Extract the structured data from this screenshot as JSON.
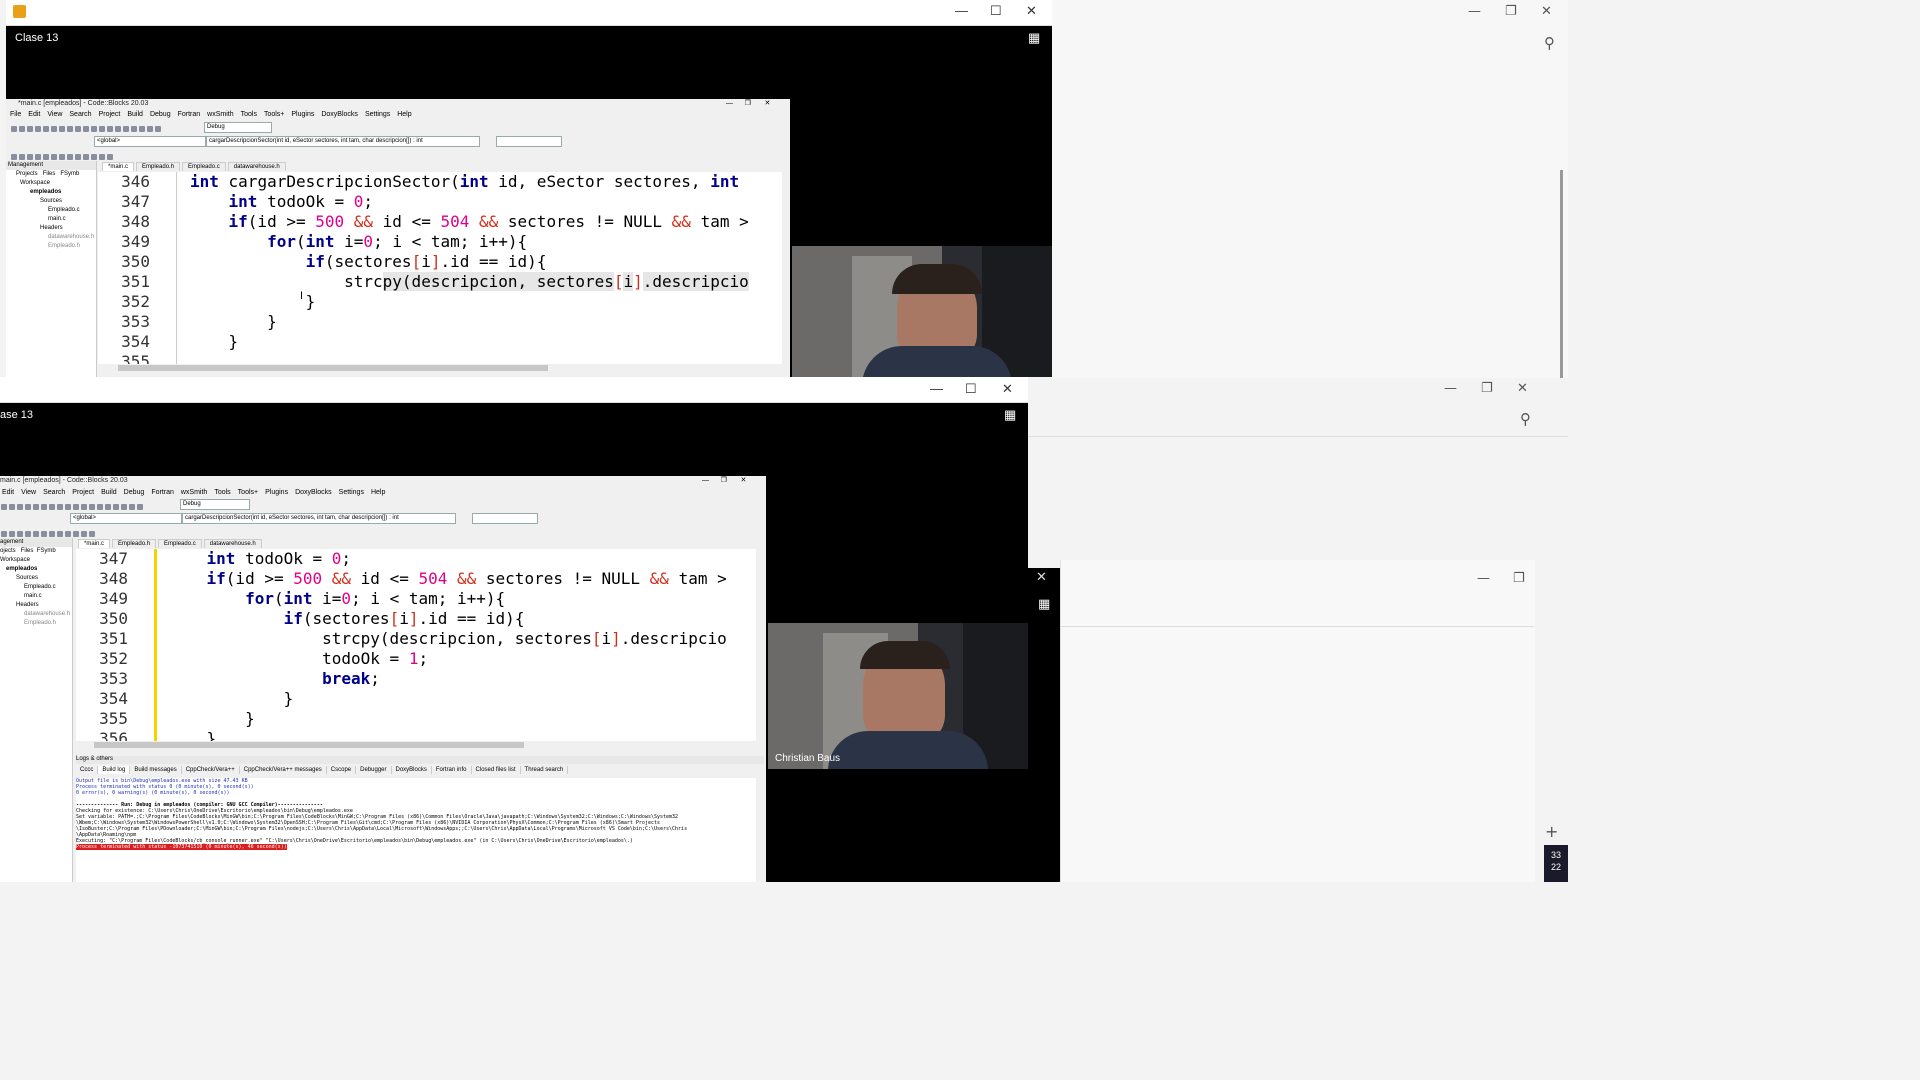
{
  "top_player": {
    "title": "Clase 13",
    "controls": [
      "—",
      "☐",
      "✕"
    ]
  },
  "bottom_player": {
    "title": "ase 13",
    "controls": [
      "—",
      "☐",
      "✕"
    ]
  },
  "codeblocks": {
    "title_top": "*main.c [empleados] - Code::Blocks 20.03",
    "title_bottom": "main.c [empleados] - Code::Blocks 20.03",
    "menu_top": [
      "File",
      "Edit",
      "View",
      "Search",
      "Project",
      "Build",
      "Debug",
      "Fortran",
      "wxSmith",
      "Tools",
      "Tools+",
      "Plugins",
      "DoxyBlocks",
      "Settings",
      "Help"
    ],
    "menu_bottom": [
      "Edit",
      "View",
      "Search",
      "Project",
      "Build",
      "Debug",
      "Fortran",
      "wxSmith",
      "Tools",
      "Tools+",
      "Plugins",
      "DoxyBlocks",
      "Settings",
      "Help"
    ],
    "build_target": "Debug",
    "scope": "<global>",
    "function_combo": "cargarDescripcionSector(int id, eSector sectores, int tam, char descripcion[]) : int",
    "file_tabs_top": [
      "*main.c",
      "Empleado.h",
      "Empleado.c",
      "datawarehouse.h"
    ],
    "file_tabs_bottom": [
      "*main.c",
      "Empleado.h",
      "Empleado.c",
      "datawarehouse.h"
    ],
    "management": {
      "label": "Management",
      "tabs": [
        "Projects",
        "Files",
        "FSymb"
      ],
      "tree": [
        "Workspace",
        "empleados",
        "Sources",
        "Empleado.c",
        "main.c",
        "Headers",
        "datawarehouse.h",
        "Empleado.h"
      ]
    },
    "logs": {
      "label": "Logs & others",
      "tabs": [
        "Cccc",
        "Build log",
        "Build messages",
        "CppCheck/Vera++",
        "CppCheck/Vera++ messages",
        "Cscope",
        "Debugger",
        "DoxyBlocks",
        "Fortran info",
        "Closed files list",
        "Thread search"
      ],
      "lines": [
        "Output file is bin\\Debug\\empleados.exe with size 47.43 KB",
        "Process terminated with status 0 (0 minute(s), 0 second(s))",
        "0 error(s), 0 warning(s) (0 minute(s), 0 second(s))",
        "",
        "-------------- Run: Debug in empleados (compiler: GNU GCC Compiler)---------------",
        "Checking for existence: C:\\Users\\Chris\\OneDrive\\Escritorio\\empleados\\bin\\Debug\\empleados.exe",
        "Set variable: PATH=.;C:\\Program Files\\CodeBlocks\\MinGW\\bin;C:\\Program Files\\CodeBlocks\\MinGW;C:\\Program Files (x86)\\Common Files\\Oracle\\Java\\javapath;C:\\Windows\\System32;C:\\Windows;C:\\Windows\\System32",
        "\\Wbem;C:\\Windows\\System32\\WindowsPowerShell\\v1.0;C:\\Windows\\System32\\OpenSSH;C:\\Program Files\\Git\\cmd;C:\\Program Files (x86)\\NVIDIA Corporation\\PhysX\\Common;C:\\Program Files (x86)\\Smart Projects",
        "\\IsoBuster;C:\\Program Files\\PDownloader;C:\\MinGW\\bin;C:\\Program Files\\nodejs;C:\\Users\\Chris\\AppData\\Local\\Microsoft\\WindowsApps;;C:\\Users\\Chris\\AppData\\Local\\Programs\\Microsoft VS Code\\bin;C:\\Users\\Chris",
        "\\AppData\\Roaming\\npm",
        "Executing: \"C:\\Program Files\\CodeBlocks/cb_console_runner.exe\" \"C:\\Users\\Chris\\OneDrive\\Escritorio\\empleados\\bin\\Debug\\empleados.exe\"  (in C:\\Users\\Chris\\OneDrive\\Escritorio\\empleados\\.)",
        "Process terminated with status -1073741510 (0 minute(s), 46 second(s))"
      ]
    }
  },
  "code_top": [
    {
      "n": "346",
      "segs": [
        [
          "kw",
          "int"
        ],
        [
          "t",
          " cargarDescripcionSector("
        ],
        [
          "kw",
          "int"
        ],
        [
          "t",
          " id, eSector sectores, "
        ],
        [
          "kw",
          "int"
        ]
      ]
    },
    {
      "n": "347",
      "segs": [
        [
          "t",
          "    "
        ],
        [
          "kw",
          "int"
        ],
        [
          "t",
          " todoOk = "
        ],
        [
          "num",
          "0"
        ],
        [
          "t",
          ";"
        ]
      ]
    },
    {
      "n": "348",
      "segs": [
        [
          "t",
          "    "
        ],
        [
          "kw",
          "if"
        ],
        [
          "t",
          "(id >= "
        ],
        [
          "num",
          "500"
        ],
        [
          "op",
          " && "
        ],
        [
          "t",
          "id <= "
        ],
        [
          "num",
          "504"
        ],
        [
          "op",
          " && "
        ],
        [
          "t",
          "sectores != NULL "
        ],
        [
          "op",
          "&&"
        ],
        [
          "t",
          " tam >"
        ]
      ]
    },
    {
      "n": "349",
      "segs": [
        [
          "t",
          "        "
        ],
        [
          "kw",
          "for"
        ],
        [
          "t",
          "("
        ],
        [
          "kw",
          "int"
        ],
        [
          "t",
          " i="
        ],
        [
          "num",
          "0"
        ],
        [
          "t",
          "; i < tam; i++){"
        ]
      ]
    },
    {
      "n": "350",
      "segs": [
        [
          "t",
          "            "
        ],
        [
          "kw",
          "if"
        ],
        [
          "t",
          "(sectores"
        ],
        [
          "op",
          "["
        ],
        [
          "t",
          "i"
        ],
        [
          "op",
          "]"
        ],
        [
          "t",
          ".id == id){"
        ]
      ]
    },
    {
      "n": "351",
      "segs": [
        [
          "t",
          "                strc"
        ],
        [
          "sel",
          "py(descripcion, sectores"
        ],
        [
          "op",
          "["
        ],
        [
          "sel",
          "i"
        ],
        [
          "op",
          "]"
        ],
        [
          "sel",
          ".descripcio"
        ]
      ]
    },
    {
      "n": "352",
      "segs": [
        [
          "t",
          "            }"
        ]
      ]
    },
    {
      "n": "353",
      "segs": [
        [
          "t",
          "        }"
        ]
      ]
    },
    {
      "n": "354",
      "segs": [
        [
          "t",
          "    }"
        ]
      ]
    },
    {
      "n": "355",
      "segs": [
        [
          "t",
          ""
        ]
      ]
    }
  ],
  "code_bottom": [
    {
      "n": "347",
      "segs": [
        [
          "t",
          "    "
        ],
        [
          "kw",
          "int"
        ],
        [
          "t",
          " todoOk = "
        ],
        [
          "num",
          "0"
        ],
        [
          "t",
          ";"
        ]
      ]
    },
    {
      "n": "348",
      "segs": [
        [
          "t",
          "    "
        ],
        [
          "kw",
          "if"
        ],
        [
          "t",
          "(id >= "
        ],
        [
          "num",
          "500"
        ],
        [
          "op",
          " && "
        ],
        [
          "t",
          "id <= "
        ],
        [
          "num",
          "504"
        ],
        [
          "op",
          " && "
        ],
        [
          "t",
          "sectores != NULL "
        ],
        [
          "op",
          "&&"
        ],
        [
          "t",
          " tam >"
        ]
      ]
    },
    {
      "n": "349",
      "segs": [
        [
          "t",
          "        "
        ],
        [
          "kw",
          "for"
        ],
        [
          "t",
          "("
        ],
        [
          "kw",
          "int"
        ],
        [
          "t",
          " i="
        ],
        [
          "num",
          "0"
        ],
        [
          "t",
          "; i < tam; i++){"
        ]
      ]
    },
    {
      "n": "350",
      "segs": [
        [
          "t",
          "            "
        ],
        [
          "kw",
          "if"
        ],
        [
          "t",
          "(sectores"
        ],
        [
          "op",
          "["
        ],
        [
          "t",
          "i"
        ],
        [
          "op",
          "]"
        ],
        [
          "t",
          ".id == id){"
        ]
      ]
    },
    {
      "n": "351",
      "segs": [
        [
          "t",
          "                strcpy(descripcion, sectores"
        ],
        [
          "op",
          "["
        ],
        [
          "t",
          "i"
        ],
        [
          "op",
          "]"
        ],
        [
          "t",
          ".descripcio"
        ]
      ]
    },
    {
      "n": "352",
      "segs": [
        [
          "t",
          "                todoOk = "
        ],
        [
          "num",
          "1"
        ],
        [
          "t",
          ";"
        ]
      ]
    },
    {
      "n": "353",
      "segs": [
        [
          "t",
          "                "
        ],
        [
          "kw",
          "break"
        ],
        [
          "t",
          ";"
        ]
      ]
    },
    {
      "n": "354",
      "segs": [
        [
          "t",
          "            }"
        ]
      ]
    },
    {
      "n": "355",
      "segs": [
        [
          "t",
          "        }"
        ]
      ]
    },
    {
      "n": "356",
      "segs": [
        [
          "t",
          "    }"
        ]
      ]
    }
  ],
  "participant_name": "Christian Baus",
  "colors": {
    "keyword": "#00008b",
    "number": "#e0008c",
    "operator": "#d12f1b",
    "error_bg": "#d81e1e"
  }
}
